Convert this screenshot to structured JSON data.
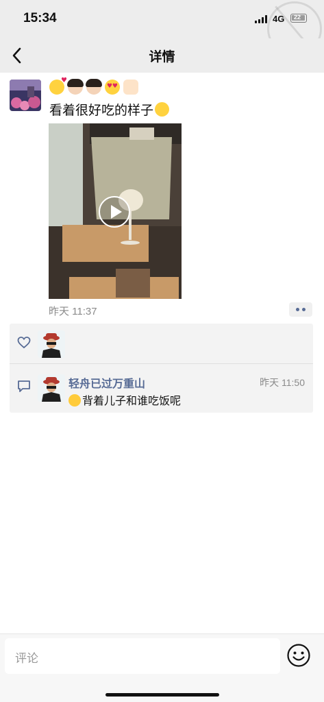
{
  "status_bar": {
    "time": "15:34",
    "network": "4G",
    "battery": "22"
  },
  "nav": {
    "title": "详情"
  },
  "post": {
    "text": "看着很好吃的样子",
    "time": "昨天 11:37",
    "emoji_icons": [
      "kiss-face-icon",
      "woman-face-icon",
      "woman-face-icon",
      "heart-eyes-icon",
      "clapping-hands-icon"
    ]
  },
  "comments": [
    {
      "name": "轻舟已过万重山",
      "time": "昨天 11:50",
      "text": "背着儿子和谁吃饭呢"
    }
  ],
  "input": {
    "placeholder": "评论"
  },
  "colors": {
    "link": "#576b95",
    "header_bg": "#ededed",
    "panel_bg": "#f3f3f3"
  }
}
